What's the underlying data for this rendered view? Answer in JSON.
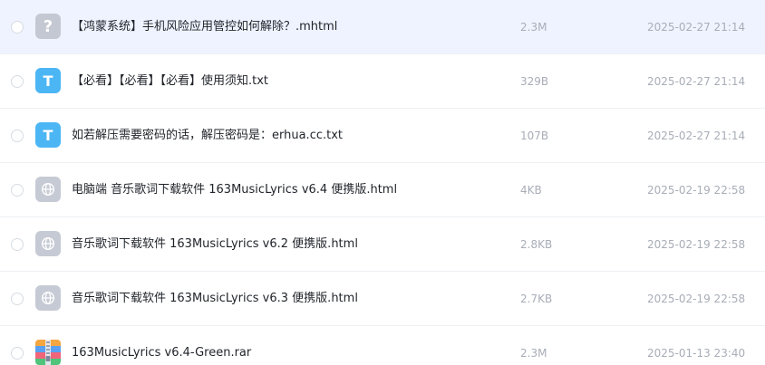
{
  "files": [
    {
      "name": "【鸿蒙系统】手机风险应用管控如何解除？.mhtml",
      "size": "2.3M",
      "date": "2025-02-27 21:14",
      "icon": "unknown-file-icon",
      "icon_glyph": "?",
      "selected": true
    },
    {
      "name": "【必看】【必看】【必看】使用须知.txt",
      "size": "329B",
      "date": "2025-02-27 21:14",
      "icon": "text-file-icon",
      "icon_glyph": "T",
      "selected": false
    },
    {
      "name": "如若解压需要密码的话，解压密码是：erhua.cc.txt",
      "size": "107B",
      "date": "2025-02-27 21:14",
      "icon": "text-file-icon",
      "icon_glyph": "T",
      "selected": false
    },
    {
      "name": "电脑端 音乐歌词下载软件 163MusicLyrics v6.4 便携版.html",
      "size": "4KB",
      "date": "2025-02-19 22:58",
      "icon": "web-file-icon",
      "icon_glyph": "",
      "selected": false
    },
    {
      "name": "音乐歌词下载软件 163MusicLyrics v6.2 便携版.html",
      "size": "2.8KB",
      "date": "2025-02-19 22:58",
      "icon": "web-file-icon",
      "icon_glyph": "",
      "selected": false
    },
    {
      "name": "音乐歌词下载软件 163MusicLyrics v6.3 便携版.html",
      "size": "2.7KB",
      "date": "2025-02-19 22:58",
      "icon": "web-file-icon",
      "icon_glyph": "",
      "selected": false
    },
    {
      "name": "163MusicLyrics v6.4-Green.rar",
      "size": "2.3M",
      "date": "2025-01-13 23:40",
      "icon": "archive-file-icon",
      "icon_glyph": "",
      "selected": false
    }
  ],
  "colors": {
    "selected_row_bg": "#eef3ff",
    "unknown_icon": "#c4c8d2",
    "text_icon": "#4cb6f4",
    "web_icon": "#c6cad4",
    "meta_text": "#a8adb7",
    "name_text": "#1f2329"
  }
}
